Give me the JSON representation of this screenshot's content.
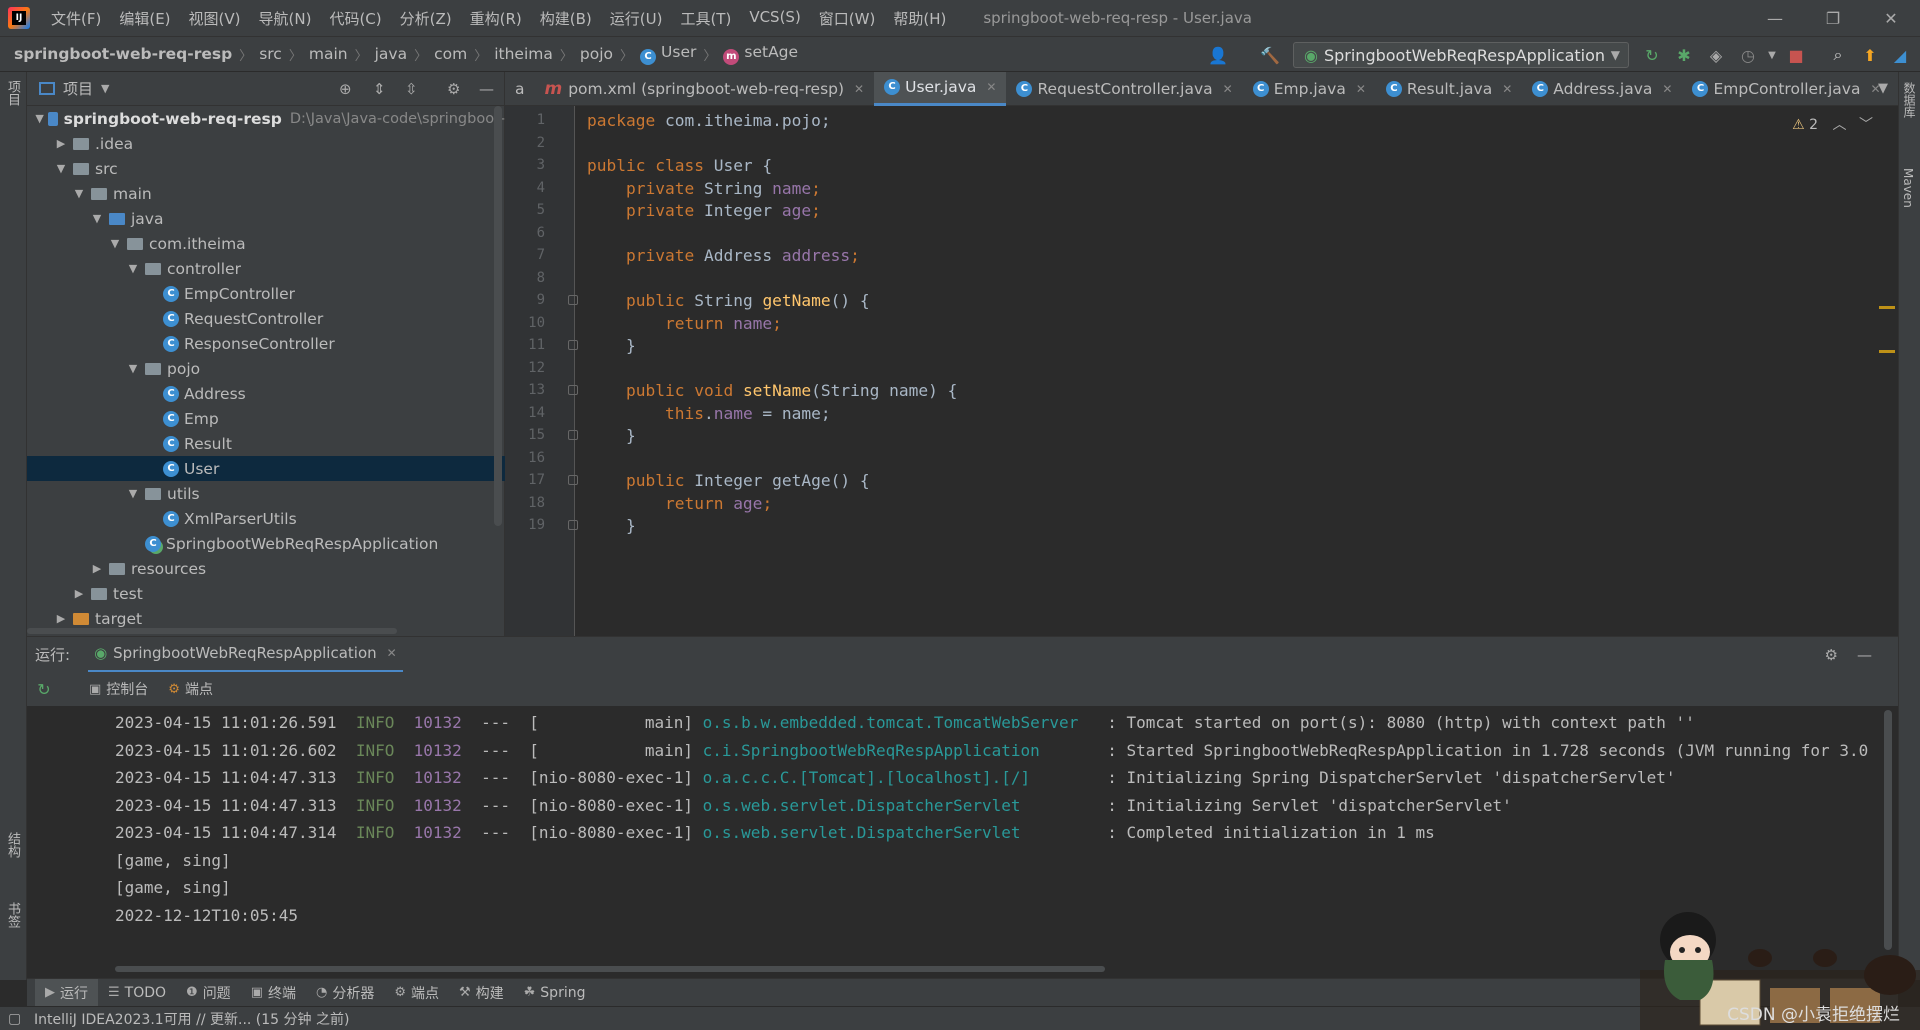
{
  "menu": {
    "items": [
      "文件(F)",
      "编辑(E)",
      "视图(V)",
      "导航(N)",
      "代码(C)",
      "分析(Z)",
      "重构(R)",
      "构建(B)",
      "运行(U)",
      "工具(T)",
      "VCS(S)",
      "窗口(W)",
      "帮助(H)"
    ],
    "window_title": "springboot-web-req-resp - User.java"
  },
  "breadcrumb": {
    "project": "springboot-web-req-resp",
    "parts": [
      "src",
      "main",
      "java",
      "com",
      "itheima",
      "pojo"
    ],
    "class": "User",
    "method": "setAge"
  },
  "run_config": "SpringbootWebReqRespApplication",
  "project_panel": {
    "title": "项目",
    "root_name": "springboot-web-req-resp",
    "root_path": "D:\\Java\\Java-code\\springboot-",
    "tree": [
      {
        "label": ".idea",
        "depth": 1,
        "arrow": "right",
        "kind": "folder"
      },
      {
        "label": "src",
        "depth": 1,
        "arrow": "down",
        "kind": "folder"
      },
      {
        "label": "main",
        "depth": 2,
        "arrow": "down",
        "kind": "folder"
      },
      {
        "label": "java",
        "depth": 3,
        "arrow": "down",
        "kind": "folder-blue"
      },
      {
        "label": "com.itheima",
        "depth": 4,
        "arrow": "down",
        "kind": "package"
      },
      {
        "label": "controller",
        "depth": 5,
        "arrow": "down",
        "kind": "package"
      },
      {
        "label": "EmpController",
        "depth": 6,
        "arrow": "",
        "kind": "class"
      },
      {
        "label": "RequestController",
        "depth": 6,
        "arrow": "",
        "kind": "class"
      },
      {
        "label": "ResponseController",
        "depth": 6,
        "arrow": "",
        "kind": "class"
      },
      {
        "label": "pojo",
        "depth": 5,
        "arrow": "down",
        "kind": "package"
      },
      {
        "label": "Address",
        "depth": 6,
        "arrow": "",
        "kind": "class"
      },
      {
        "label": "Emp",
        "depth": 6,
        "arrow": "",
        "kind": "class"
      },
      {
        "label": "Result",
        "depth": 6,
        "arrow": "",
        "kind": "class"
      },
      {
        "label": "User",
        "depth": 6,
        "arrow": "",
        "kind": "class",
        "selected": true
      },
      {
        "label": "utils",
        "depth": 5,
        "arrow": "down",
        "kind": "package"
      },
      {
        "label": "XmlParserUtils",
        "depth": 6,
        "arrow": "",
        "kind": "class"
      },
      {
        "label": "SpringbootWebReqRespApplication",
        "depth": 5,
        "arrow": "",
        "kind": "app"
      },
      {
        "label": "resources",
        "depth": 3,
        "arrow": "right",
        "kind": "folder"
      },
      {
        "label": "test",
        "depth": 2,
        "arrow": "right",
        "kind": "folder"
      },
      {
        "label": "target",
        "depth": 1,
        "arrow": "right",
        "kind": "folder-orange"
      }
    ]
  },
  "editor_tabs": [
    {
      "label": "a",
      "icon": "",
      "active": false,
      "closable": false
    },
    {
      "label": "pom.xml (springboot-web-req-resp)",
      "icon": "m",
      "active": false,
      "closable": true
    },
    {
      "label": "User.java",
      "icon": "c",
      "active": true,
      "closable": true
    },
    {
      "label": "RequestController.java",
      "icon": "c",
      "active": false,
      "closable": true
    },
    {
      "label": "Emp.java",
      "icon": "c",
      "active": false,
      "closable": true
    },
    {
      "label": "Result.java",
      "icon": "c",
      "active": false,
      "closable": true
    },
    {
      "label": "Address.java",
      "icon": "c",
      "active": false,
      "closable": true
    },
    {
      "label": "EmpController.java",
      "icon": "c",
      "active": false,
      "closable": true
    }
  ],
  "editor": {
    "warning_count": "2",
    "lines": [
      [
        {
          "t": "package",
          "c": "kw"
        },
        {
          "t": " com.itheima.pojo;",
          "c": ""
        }
      ],
      [],
      [
        {
          "t": "public class",
          "c": "kw"
        },
        {
          "t": " User {",
          "c": ""
        }
      ],
      [
        {
          "t": "    private",
          "c": "kw"
        },
        {
          "t": " String ",
          "c": ""
        },
        {
          "t": "name",
          "c": "fld"
        },
        {
          "t": ";",
          "c": "kw"
        }
      ],
      [
        {
          "t": "    private",
          "c": "kw"
        },
        {
          "t": " Integer ",
          "c": ""
        },
        {
          "t": "age",
          "c": "fld"
        },
        {
          "t": ";",
          "c": "kw"
        }
      ],
      [],
      [
        {
          "t": "    private",
          "c": "kw"
        },
        {
          "t": " Address ",
          "c": ""
        },
        {
          "t": "address",
          "c": "fld"
        },
        {
          "t": ";",
          "c": "kw"
        }
      ],
      [],
      [
        {
          "t": "    public",
          "c": "kw"
        },
        {
          "t": " String ",
          "c": ""
        },
        {
          "t": "getName",
          "c": "fn"
        },
        {
          "t": "() {",
          "c": ""
        }
      ],
      [
        {
          "t": "        return ",
          "c": "kw"
        },
        {
          "t": "name",
          "c": "fld"
        },
        {
          "t": ";",
          "c": "kw"
        }
      ],
      [
        {
          "t": "    }",
          "c": ""
        }
      ],
      [],
      [
        {
          "t": "    public void",
          "c": "kw"
        },
        {
          "t": " ",
          "c": ""
        },
        {
          "t": "setName",
          "c": "fn"
        },
        {
          "t": "(String name) {",
          "c": ""
        }
      ],
      [
        {
          "t": "        this",
          "c": "kw"
        },
        {
          "t": ".",
          "c": ""
        },
        {
          "t": "name",
          "c": "fld"
        },
        {
          "t": " = name;",
          "c": ""
        }
      ],
      [
        {
          "t": "    }",
          "c": ""
        }
      ],
      [],
      [
        {
          "t": "    public",
          "c": "kw"
        },
        {
          "t": " Integer getAge() {",
          "c": ""
        }
      ],
      [
        {
          "t": "        return ",
          "c": "kw"
        },
        {
          "t": "age",
          "c": "fld"
        },
        {
          "t": ";",
          "c": "kw"
        }
      ],
      [
        {
          "t": "    }",
          "c": ""
        }
      ]
    ]
  },
  "run_panel": {
    "label": "运行:",
    "tab": "SpringbootWebReqRespApplication",
    "subtabs": [
      "控制台",
      "端点"
    ],
    "log": [
      {
        "time": "2023-04-15 11:01:26.591",
        "level": "INFO",
        "pid": "10132",
        "sep": "---",
        "thread": "[           main]",
        "logger": "o.s.b.w.embedded.tomcat.TomcatWebServer ",
        "msg": ": Tomcat started on port(s): 8080 (http) with context path ''"
      },
      {
        "time": "2023-04-15 11:01:26.602",
        "level": "INFO",
        "pid": "10132",
        "sep": "---",
        "thread": "[           main]",
        "logger": "c.i.SpringbootWebReqRespApplication     ",
        "msg": ": Started SpringbootWebReqRespApplication in 1.728 seconds (JVM running for 3.0"
      },
      {
        "time": "2023-04-15 11:04:47.313",
        "level": "INFO",
        "pid": "10132",
        "sep": "---",
        "thread": "[nio-8080-exec-1]",
        "logger": "o.a.c.c.C.[Tomcat].[localhost].[/]      ",
        "msg": ": Initializing Spring DispatcherServlet 'dispatcherServlet'"
      },
      {
        "time": "2023-04-15 11:04:47.313",
        "level": "INFO",
        "pid": "10132",
        "sep": "---",
        "thread": "[nio-8080-exec-1]",
        "logger": "o.s.web.servlet.DispatcherServlet       ",
        "msg": ": Initializing Servlet 'dispatcherServlet'"
      },
      {
        "time": "2023-04-15 11:04:47.314",
        "level": "INFO",
        "pid": "10132",
        "sep": "---",
        "thread": "[nio-8080-exec-1]",
        "logger": "o.s.web.servlet.DispatcherServlet       ",
        "msg": ": Completed initialization in 1 ms"
      }
    ],
    "plain_lines": [
      "[game, sing]",
      "[game, sing]",
      "2022-12-12T10:05:45"
    ]
  },
  "bottom_tabs": [
    {
      "icon": "▶",
      "label": "运行"
    },
    {
      "icon": "☰",
      "label": "TODO"
    },
    {
      "icon": "❶",
      "label": "问题"
    },
    {
      "icon": "▣",
      "label": "终端"
    },
    {
      "icon": "◔",
      "label": "分析器"
    },
    {
      "icon": "⚙",
      "label": "端点"
    },
    {
      "icon": "⚒",
      "label": "构建"
    },
    {
      "icon": "☘",
      "label": "Spring"
    }
  ],
  "status_text": "IntelliJ IDEA2023.1可用 // 更新... (15 分钟 之前)",
  "side_labels": {
    "left_top": "项目",
    "left_structure": "结构",
    "left_bookmarks": "书签",
    "right_db": "数据库",
    "right_maven": "Maven"
  },
  "watermark": "CSDN @小袁拒绝摆烂",
  "colors": {
    "keyword": "#cc7832",
    "field": "#9876aa",
    "method": "#ffc66d",
    "logger": "#299999",
    "info": "#6a8759",
    "selection": "#0d293e"
  }
}
